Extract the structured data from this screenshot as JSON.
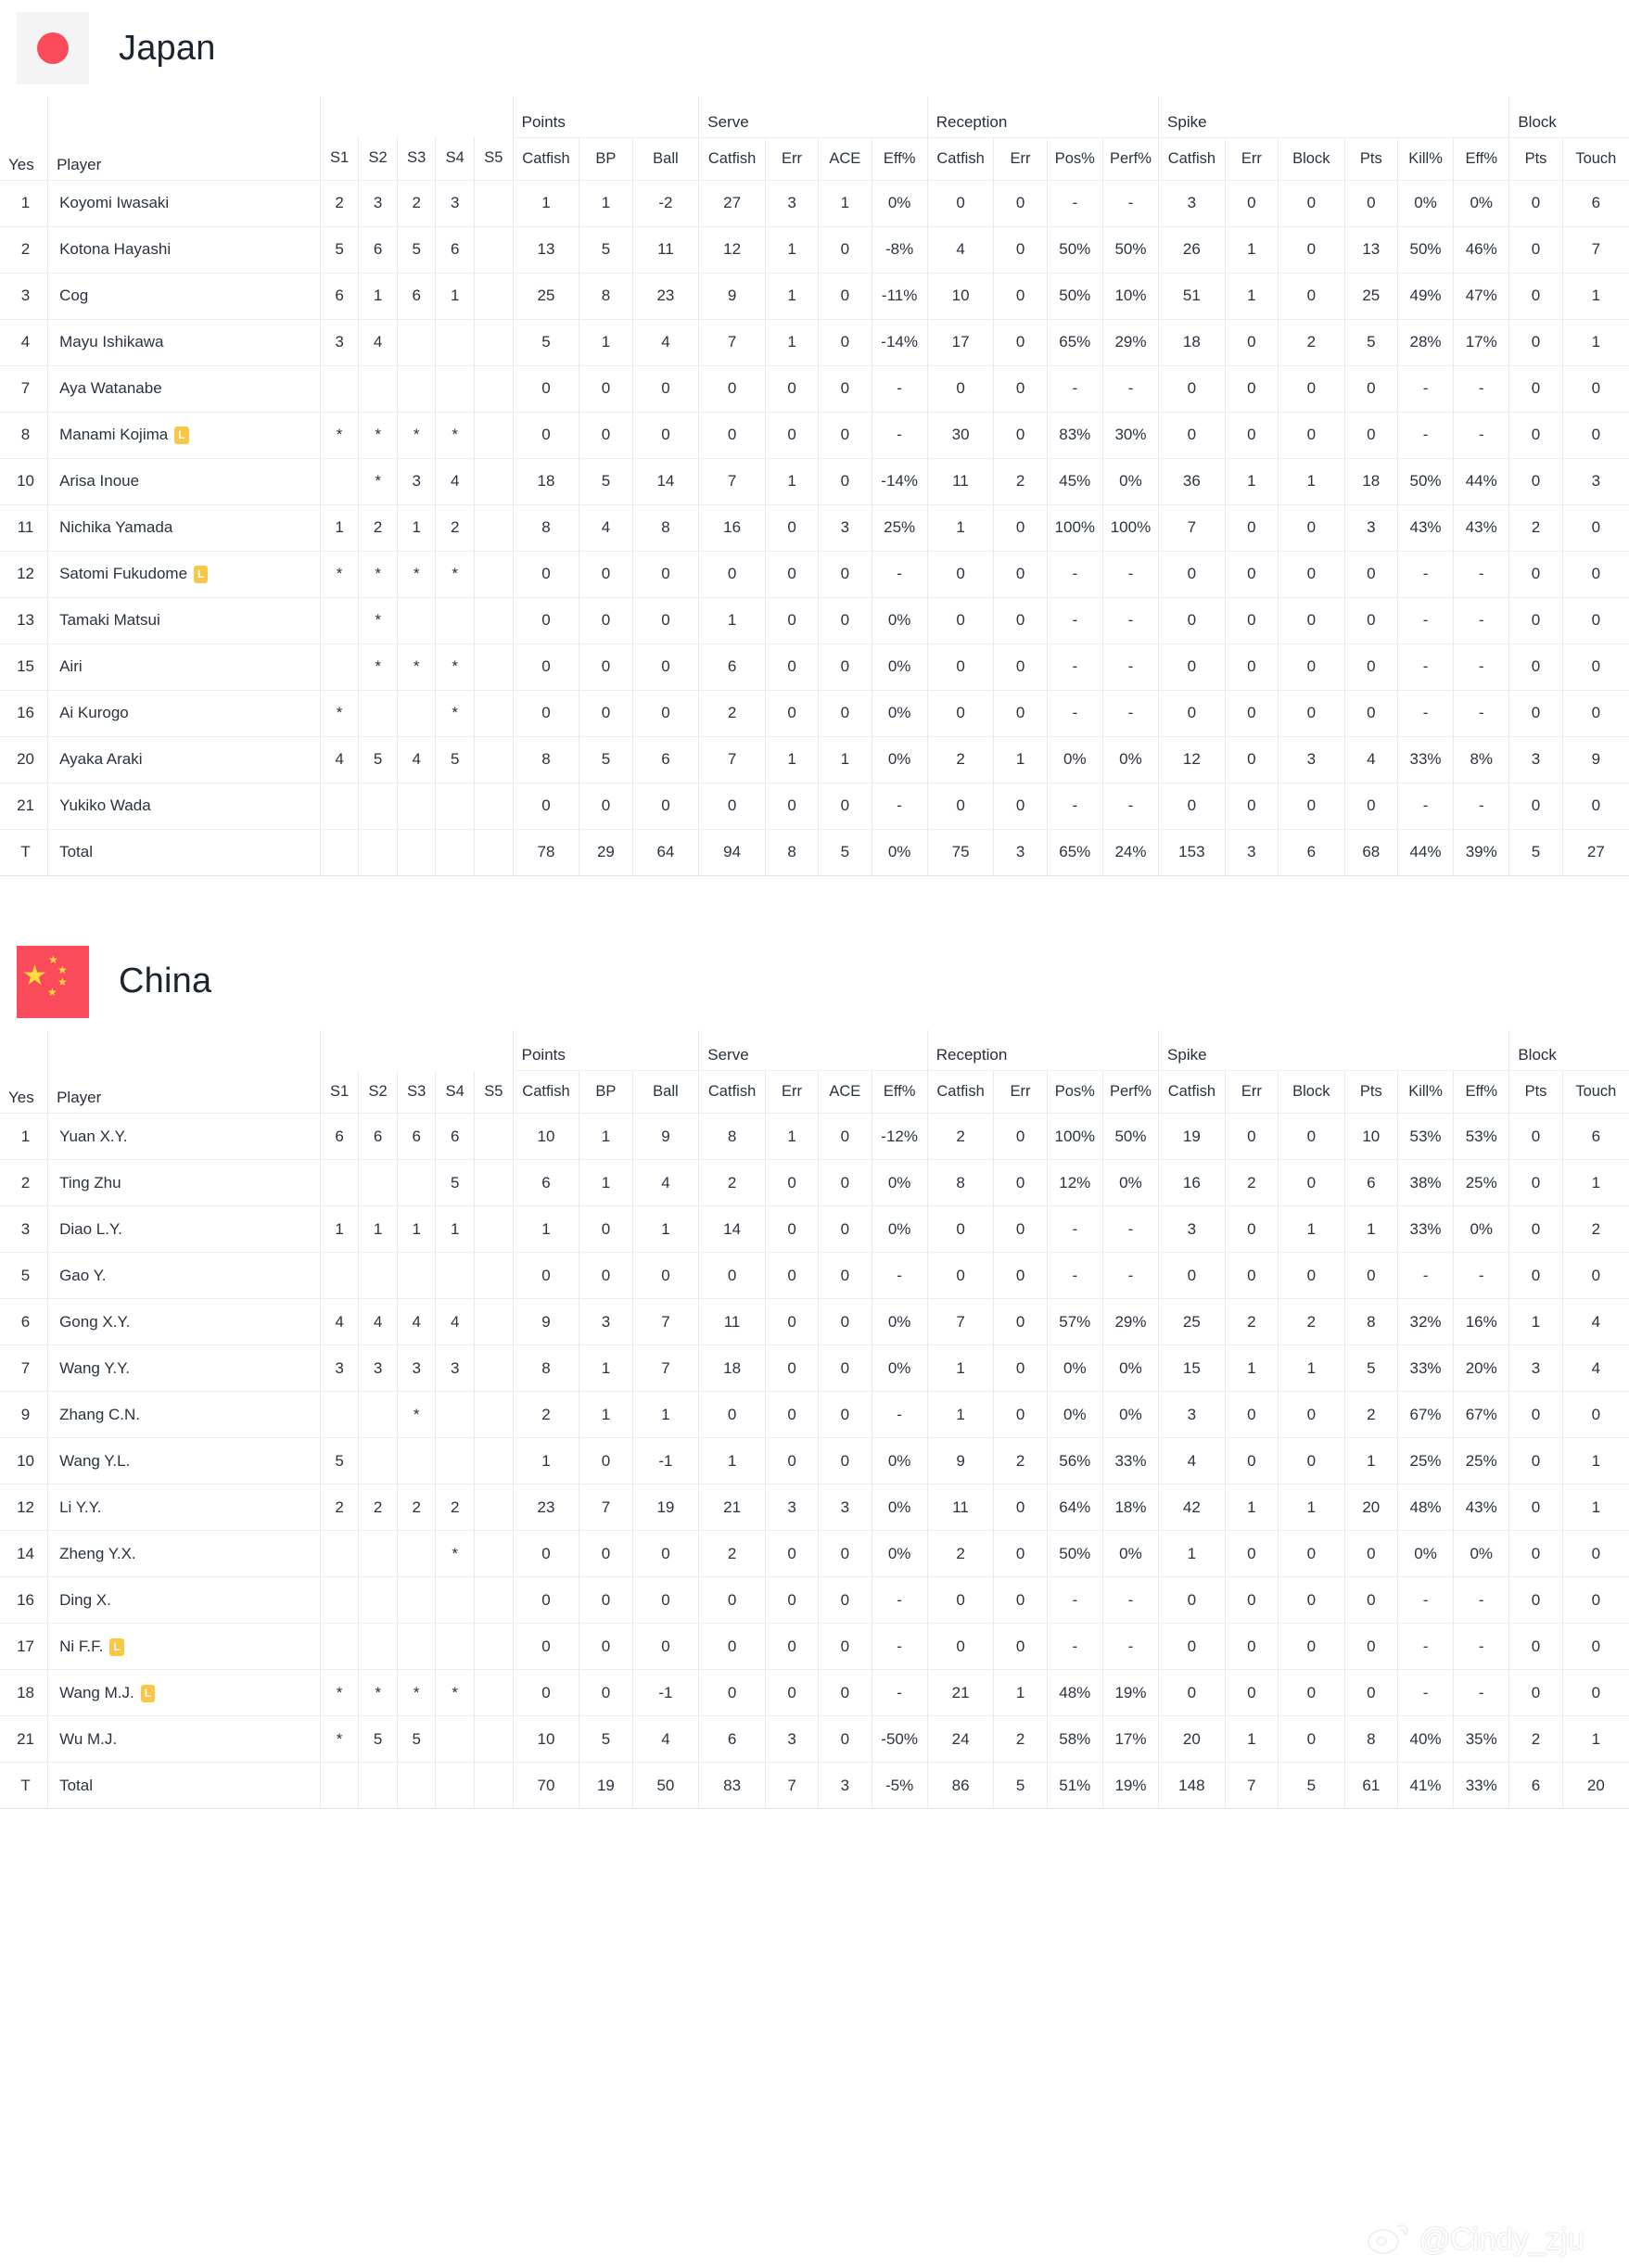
{
  "columns": {
    "row_head": [
      "Yes",
      "Player"
    ],
    "sets": [
      "S1",
      "S2",
      "S3",
      "S4",
      "S5"
    ],
    "groups": [
      {
        "name": "Points",
        "subs": [
          "Catfish",
          "BP",
          "Ball"
        ]
      },
      {
        "name": "Serve",
        "subs": [
          "Catfish",
          "Err",
          "ACE",
          "Eff%"
        ]
      },
      {
        "name": "Reception",
        "subs": [
          "Catfish",
          "Err",
          "Pos%",
          "Perf%"
        ]
      },
      {
        "name": "Spike",
        "subs": [
          "Catfish",
          "Err",
          "Block",
          "Pts",
          "Kill%",
          "Eff%"
        ]
      },
      {
        "name": "Block",
        "subs": [
          "Pts",
          "Touch"
        ]
      }
    ]
  },
  "libero_badge": "L",
  "watermark": {
    "text": "@Cindy_zju",
    "logo": "weibo-icon"
  },
  "teams": [
    {
      "name": "Japan",
      "flag": "flag-japan",
      "rows": [
        {
          "yes": "1",
          "player": "Koyomi Iwasaki",
          "libero": false,
          "cells": [
            "2",
            "3",
            "2",
            "3",
            "",
            "1",
            "1",
            "-2",
            "27",
            "3",
            "1",
            "0%",
            "0",
            "0",
            "-",
            "-",
            "3",
            "0",
            "0",
            "0",
            "0%",
            "0%",
            "0",
            "6"
          ]
        },
        {
          "yes": "2",
          "player": "Kotona Hayashi",
          "libero": false,
          "cells": [
            "5",
            "6",
            "5",
            "6",
            "",
            "13",
            "5",
            "11",
            "12",
            "1",
            "0",
            "-8%",
            "4",
            "0",
            "50%",
            "50%",
            "26",
            "1",
            "0",
            "13",
            "50%",
            "46%",
            "0",
            "7"
          ]
        },
        {
          "yes": "3",
          "player": "Cog",
          "libero": false,
          "cells": [
            "6",
            "1",
            "6",
            "1",
            "",
            "25",
            "8",
            "23",
            "9",
            "1",
            "0",
            "-11%",
            "10",
            "0",
            "50%",
            "10%",
            "51",
            "1",
            "0",
            "25",
            "49%",
            "47%",
            "0",
            "1"
          ]
        },
        {
          "yes": "4",
          "player": "Mayu Ishikawa",
          "libero": false,
          "cells": [
            "3",
            "4",
            "",
            "",
            "",
            "5",
            "1",
            "4",
            "7",
            "1",
            "0",
            "-14%",
            "17",
            "0",
            "65%",
            "29%",
            "18",
            "0",
            "2",
            "5",
            "28%",
            "17%",
            "0",
            "1"
          ]
        },
        {
          "yes": "7",
          "player": "Aya Watanabe",
          "libero": false,
          "cells": [
            "",
            "",
            "",
            "",
            "",
            "0",
            "0",
            "0",
            "0",
            "0",
            "0",
            "-",
            "0",
            "0",
            "-",
            "-",
            "0",
            "0",
            "0",
            "0",
            "-",
            "-",
            "0",
            "0"
          ]
        },
        {
          "yes": "8",
          "player": "Manami Kojima",
          "libero": true,
          "cells": [
            "*",
            "*",
            "*",
            "*",
            "",
            "0",
            "0",
            "0",
            "0",
            "0",
            "0",
            "-",
            "30",
            "0",
            "83%",
            "30%",
            "0",
            "0",
            "0",
            "0",
            "-",
            "-",
            "0",
            "0"
          ]
        },
        {
          "yes": "10",
          "player": "Arisa Inoue",
          "libero": false,
          "cells": [
            "",
            "*",
            "3",
            "4",
            "",
            "18",
            "5",
            "14",
            "7",
            "1",
            "0",
            "-14%",
            "11",
            "2",
            "45%",
            "0%",
            "36",
            "1",
            "1",
            "18",
            "50%",
            "44%",
            "0",
            "3"
          ]
        },
        {
          "yes": "11",
          "player": "Nichika Yamada",
          "libero": false,
          "cells": [
            "1",
            "2",
            "1",
            "2",
            "",
            "8",
            "4",
            "8",
            "16",
            "0",
            "3",
            "25%",
            "1",
            "0",
            "100%",
            "100%",
            "7",
            "0",
            "0",
            "3",
            "43%",
            "43%",
            "2",
            "0"
          ]
        },
        {
          "yes": "12",
          "player": "Satomi Fukudome",
          "libero": true,
          "cells": [
            "*",
            "*",
            "*",
            "*",
            "",
            "0",
            "0",
            "0",
            "0",
            "0",
            "0",
            "-",
            "0",
            "0",
            "-",
            "-",
            "0",
            "0",
            "0",
            "0",
            "-",
            "-",
            "0",
            "0"
          ]
        },
        {
          "yes": "13",
          "player": "Tamaki Matsui",
          "libero": false,
          "cells": [
            "",
            "*",
            "",
            "",
            "",
            "0",
            "0",
            "0",
            "1",
            "0",
            "0",
            "0%",
            "0",
            "0",
            "-",
            "-",
            "0",
            "0",
            "0",
            "0",
            "-",
            "-",
            "0",
            "0"
          ]
        },
        {
          "yes": "15",
          "player": "Airi",
          "libero": false,
          "cells": [
            "",
            "*",
            "*",
            "*",
            "",
            "0",
            "0",
            "0",
            "6",
            "0",
            "0",
            "0%",
            "0",
            "0",
            "-",
            "-",
            "0",
            "0",
            "0",
            "0",
            "-",
            "-",
            "0",
            "0"
          ]
        },
        {
          "yes": "16",
          "player": "Ai Kurogo",
          "libero": false,
          "cells": [
            "*",
            "",
            "",
            "*",
            "",
            "0",
            "0",
            "0",
            "2",
            "0",
            "0",
            "0%",
            "0",
            "0",
            "-",
            "-",
            "0",
            "0",
            "0",
            "0",
            "-",
            "-",
            "0",
            "0"
          ]
        },
        {
          "yes": "20",
          "player": "Ayaka Araki",
          "libero": false,
          "cells": [
            "4",
            "5",
            "4",
            "5",
            "",
            "8",
            "5",
            "6",
            "7",
            "1",
            "1",
            "0%",
            "2",
            "1",
            "0%",
            "0%",
            "12",
            "0",
            "3",
            "4",
            "33%",
            "8%",
            "3",
            "9"
          ]
        },
        {
          "yes": "21",
          "player": "Yukiko Wada",
          "libero": false,
          "cells": [
            "",
            "",
            "",
            "",
            "",
            "0",
            "0",
            "0",
            "0",
            "0",
            "0",
            "-",
            "0",
            "0",
            "-",
            "-",
            "0",
            "0",
            "0",
            "0",
            "-",
            "-",
            "0",
            "0"
          ]
        },
        {
          "yes": "T",
          "player": "Total",
          "libero": false,
          "cells": [
            "",
            "",
            "",
            "",
            "",
            "78",
            "29",
            "64",
            "94",
            "8",
            "5",
            "0%",
            "75",
            "3",
            "65%",
            "24%",
            "153",
            "3",
            "6",
            "68",
            "44%",
            "39%",
            "5",
            "27"
          ]
        }
      ]
    },
    {
      "name": "China",
      "flag": "flag-china",
      "rows": [
        {
          "yes": "1",
          "player": "Yuan X.Y.",
          "libero": false,
          "cells": [
            "6",
            "6",
            "6",
            "6",
            "",
            "10",
            "1",
            "9",
            "8",
            "1",
            "0",
            "-12%",
            "2",
            "0",
            "100%",
            "50%",
            "19",
            "0",
            "0",
            "10",
            "53%",
            "53%",
            "0",
            "6"
          ]
        },
        {
          "yes": "2",
          "player": "Ting Zhu",
          "libero": false,
          "cells": [
            "",
            "",
            "",
            "5",
            "",
            "6",
            "1",
            "4",
            "2",
            "0",
            "0",
            "0%",
            "8",
            "0",
            "12%",
            "0%",
            "16",
            "2",
            "0",
            "6",
            "38%",
            "25%",
            "0",
            "1"
          ]
        },
        {
          "yes": "3",
          "player": "Diao L.Y.",
          "libero": false,
          "cells": [
            "1",
            "1",
            "1",
            "1",
            "",
            "1",
            "0",
            "1",
            "14",
            "0",
            "0",
            "0%",
            "0",
            "0",
            "-",
            "-",
            "3",
            "0",
            "1",
            "1",
            "33%",
            "0%",
            "0",
            "2"
          ]
        },
        {
          "yes": "5",
          "player": "Gao Y.",
          "libero": false,
          "cells": [
            "",
            "",
            "",
            "",
            "",
            "0",
            "0",
            "0",
            "0",
            "0",
            "0",
            "-",
            "0",
            "0",
            "-",
            "-",
            "0",
            "0",
            "0",
            "0",
            "-",
            "-",
            "0",
            "0"
          ]
        },
        {
          "yes": "6",
          "player": "Gong X.Y.",
          "libero": false,
          "cells": [
            "4",
            "4",
            "4",
            "4",
            "",
            "9",
            "3",
            "7",
            "11",
            "0",
            "0",
            "0%",
            "7",
            "0",
            "57%",
            "29%",
            "25",
            "2",
            "2",
            "8",
            "32%",
            "16%",
            "1",
            "4"
          ]
        },
        {
          "yes": "7",
          "player": "Wang Y.Y.",
          "libero": false,
          "cells": [
            "3",
            "3",
            "3",
            "3",
            "",
            "8",
            "1",
            "7",
            "18",
            "0",
            "0",
            "0%",
            "1",
            "0",
            "0%",
            "0%",
            "15",
            "1",
            "1",
            "5",
            "33%",
            "20%",
            "3",
            "4"
          ]
        },
        {
          "yes": "9",
          "player": "Zhang C.N.",
          "libero": false,
          "cells": [
            "",
            "",
            "*",
            "",
            "",
            "2",
            "1",
            "1",
            "0",
            "0",
            "0",
            "-",
            "1",
            "0",
            "0%",
            "0%",
            "3",
            "0",
            "0",
            "2",
            "67%",
            "67%",
            "0",
            "0"
          ]
        },
        {
          "yes": "10",
          "player": "Wang Y.L.",
          "libero": false,
          "cells": [
            "5",
            "",
            "",
            "",
            "",
            "1",
            "0",
            "-1",
            "1",
            "0",
            "0",
            "0%",
            "9",
            "2",
            "56%",
            "33%",
            "4",
            "0",
            "0",
            "1",
            "25%",
            "25%",
            "0",
            "1"
          ]
        },
        {
          "yes": "12",
          "player": "Li Y.Y.",
          "libero": false,
          "cells": [
            "2",
            "2",
            "2",
            "2",
            "",
            "23",
            "7",
            "19",
            "21",
            "3",
            "3",
            "0%",
            "11",
            "0",
            "64%",
            "18%",
            "42",
            "1",
            "1",
            "20",
            "48%",
            "43%",
            "0",
            "1"
          ]
        },
        {
          "yes": "14",
          "player": "Zheng Y.X.",
          "libero": false,
          "cells": [
            "",
            "",
            "",
            "*",
            "",
            "0",
            "0",
            "0",
            "2",
            "0",
            "0",
            "0%",
            "2",
            "0",
            "50%",
            "0%",
            "1",
            "0",
            "0",
            "0",
            "0%",
            "0%",
            "0",
            "0"
          ]
        },
        {
          "yes": "16",
          "player": "Ding X.",
          "libero": false,
          "cells": [
            "",
            "",
            "",
            "",
            "",
            "0",
            "0",
            "0",
            "0",
            "0",
            "0",
            "-",
            "0",
            "0",
            "-",
            "-",
            "0",
            "0",
            "0",
            "0",
            "-",
            "-",
            "0",
            "0"
          ]
        },
        {
          "yes": "17",
          "player": "Ni F.F.",
          "libero": true,
          "cells": [
            "",
            "",
            "",
            "",
            "",
            "0",
            "0",
            "0",
            "0",
            "0",
            "0",
            "-",
            "0",
            "0",
            "-",
            "-",
            "0",
            "0",
            "0",
            "0",
            "-",
            "-",
            "0",
            "0"
          ]
        },
        {
          "yes": "18",
          "player": "Wang M.J.",
          "libero": true,
          "cells": [
            "*",
            "*",
            "*",
            "*",
            "",
            "0",
            "0",
            "-1",
            "0",
            "0",
            "0",
            "-",
            "21",
            "1",
            "48%",
            "19%",
            "0",
            "0",
            "0",
            "0",
            "-",
            "-",
            "0",
            "0"
          ]
        },
        {
          "yes": "21",
          "player": "Wu M.J.",
          "libero": false,
          "cells": [
            "*",
            "5",
            "5",
            "",
            "",
            "10",
            "5",
            "4",
            "6",
            "3",
            "0",
            "-50%",
            "24",
            "2",
            "58%",
            "17%",
            "20",
            "1",
            "0",
            "8",
            "40%",
            "35%",
            "2",
            "1"
          ]
        },
        {
          "yes": "T",
          "player": "Total",
          "libero": false,
          "cells": [
            "",
            "",
            "",
            "",
            "",
            "70",
            "19",
            "50",
            "83",
            "7",
            "3",
            "-5%",
            "86",
            "5",
            "51%",
            "19%",
            "148",
            "7",
            "5",
            "61",
            "41%",
            "33%",
            "6",
            "20"
          ]
        }
      ]
    }
  ]
}
